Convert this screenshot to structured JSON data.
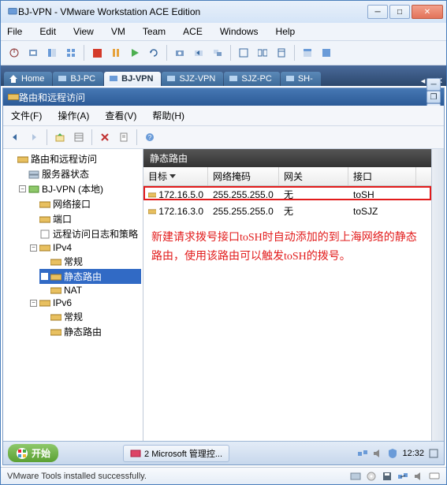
{
  "window": {
    "title": "BJ-VPN - VMware Workstation ACE Edition"
  },
  "menubar": [
    "File",
    "Edit",
    "View",
    "VM",
    "Team",
    "ACE",
    "Windows",
    "Help"
  ],
  "tabs": [
    {
      "label": "Home",
      "icon": "home"
    },
    {
      "label": "BJ-PC",
      "icon": "monitor"
    },
    {
      "label": "BJ-VPN",
      "icon": "monitor",
      "active": true
    },
    {
      "label": "SJZ-VPN",
      "icon": "monitor"
    },
    {
      "label": "SJZ-PC",
      "icon": "monitor"
    },
    {
      "label": "SH-",
      "icon": "monitor"
    }
  ],
  "inner": {
    "title": "路由和远程访问",
    "menubar": [
      "文件(F)",
      "操作(A)",
      "查看(V)",
      "帮助(H)"
    ]
  },
  "tree": {
    "root": "路由和远程访问",
    "server_status": "服务器状态",
    "bj_vpn": "BJ-VPN (本地)",
    "net_if": "网络接口",
    "ports": "端口",
    "remote_log": "远程访问日志和策略",
    "ipv4": "IPv4",
    "ipv4_general": "常规",
    "ipv4_static": "静态路由",
    "ipv4_nat": "NAT",
    "ipv6": "IPv6",
    "ipv6_general": "常规",
    "ipv6_static": "静态路由"
  },
  "pane": {
    "title": "静态路由",
    "columns": [
      "目标",
      "网络掩码",
      "网关",
      "接口"
    ],
    "rows": [
      {
        "dest": "172.16.5.0",
        "mask": "255.255.255.0",
        "gw": "无",
        "iface": "toSH",
        "highlight": true
      },
      {
        "dest": "172.16.3.0",
        "mask": "255.255.255.0",
        "gw": "无",
        "iface": "toSJZ"
      }
    ],
    "annotation": "新建请求拨号接口toSH时自动添加的到上海网络的静态路由，使用该路由可以触发toSH的拨号。"
  },
  "taskbar": {
    "start": "开始",
    "item": "2 Microsoft 管理控...",
    "clock": "12:32"
  },
  "status": "VMware Tools installed successfully."
}
